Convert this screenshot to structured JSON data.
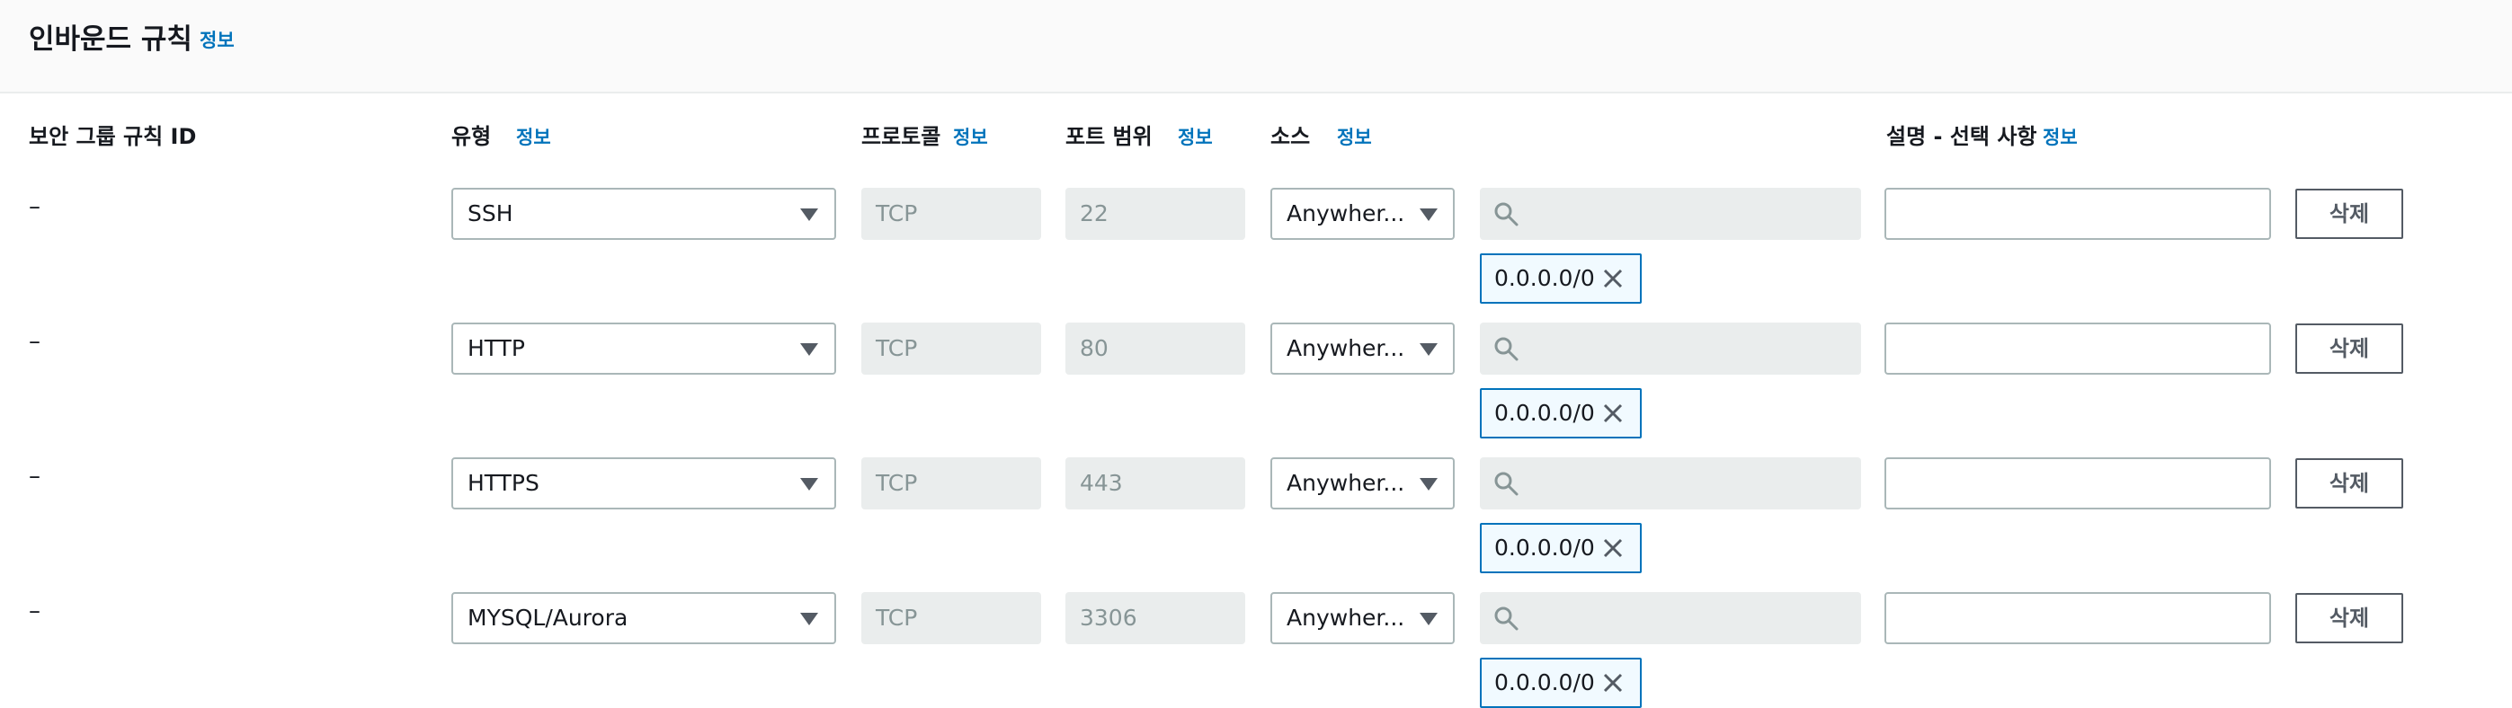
{
  "header": {
    "title": "인바운드 규칙",
    "info_link": "정보"
  },
  "columns": {
    "rule_id": "보안 그룹 규칙 ID",
    "type": "유형",
    "type_info": "정보",
    "protocol": "프로토콜",
    "protocol_info": "정보",
    "port_range": "포트 범위",
    "port_range_info": "정보",
    "source": "소스",
    "source_info": "정보",
    "description": "설명 - 선택 사항",
    "description_info": "정보"
  },
  "rules": [
    {
      "rule_id": "–",
      "type": "SSH",
      "protocol": "TCP",
      "port_range": "22",
      "source": "Anywher...",
      "cidr": "0.0.0.0/0",
      "description": "",
      "delete_label": "삭제"
    },
    {
      "rule_id": "–",
      "type": "HTTP",
      "protocol": "TCP",
      "port_range": "80",
      "source": "Anywher...",
      "cidr": "0.0.0.0/0",
      "description": "",
      "delete_label": "삭제"
    },
    {
      "rule_id": "–",
      "type": "HTTPS",
      "protocol": "TCP",
      "port_range": "443",
      "source": "Anywher...",
      "cidr": "0.0.0.0/0",
      "description": "",
      "delete_label": "삭제"
    },
    {
      "rule_id": "–",
      "type": "MYSQL/Aurora",
      "protocol": "TCP",
      "port_range": "3306",
      "source": "Anywher...",
      "cidr": "0.0.0.0/0",
      "description": "",
      "delete_label": "삭제"
    }
  ],
  "colors": {
    "accent": "#0073bb",
    "token_bg": "#f1faff",
    "disabled_bg": "#eaeded"
  }
}
